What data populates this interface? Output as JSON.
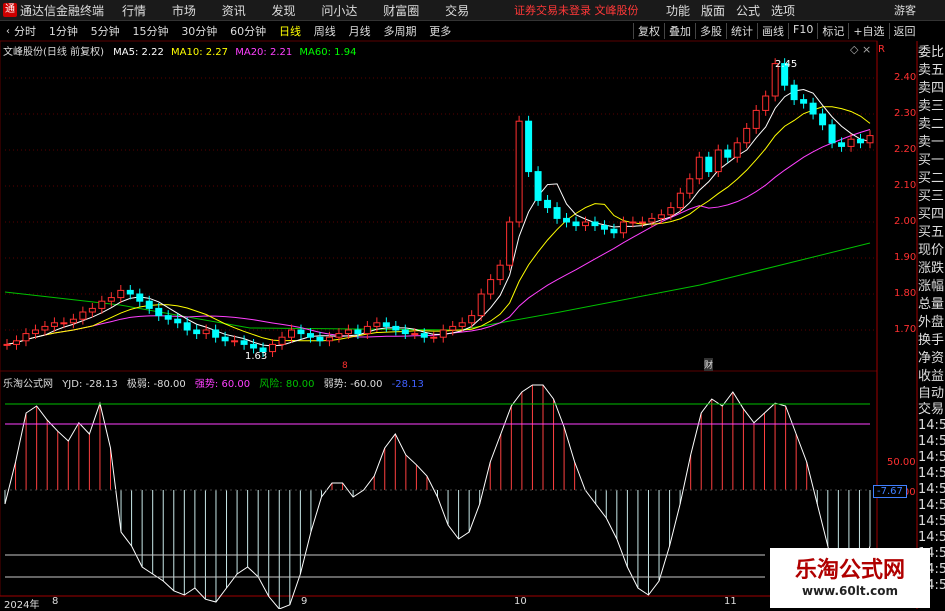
{
  "titlebar": {
    "logo": "通",
    "app_name": "通达信金融终端",
    "menus": [
      "行情",
      "市场",
      "资讯",
      "发现",
      "问小达",
      "财富圈",
      "交易"
    ],
    "notice": "证券交易未登录  文峰股份",
    "right_menus": [
      "功能",
      "版面",
      "公式",
      "选项"
    ],
    "guest": "游客"
  },
  "toolbar": {
    "periods": [
      "分时",
      "1分钟",
      "5分钟",
      "15分钟",
      "30分钟",
      "60分钟",
      "日线",
      "周线",
      "月线",
      "多周期",
      "更多"
    ],
    "active_period": "日线",
    "tools": [
      "复权",
      "叠加",
      "多股",
      "统计",
      "画线",
      "F10",
      "标记",
      "+自选",
      "返回"
    ]
  },
  "main_chart": {
    "stock_label": "文峰股份(日线 前复权)",
    "ma5": "MA5: 2.22",
    "ma10": "MA10: 2.27",
    "ma20": "MA20: 2.21",
    "ma60": "MA60: 1.94",
    "colors": {
      "ma5": "#ffffff",
      "ma10": "#ffff00",
      "ma20": "#ff40ff",
      "ma60": "#00ff00",
      "up": "#ff3030",
      "down": "#00ffff"
    },
    "price_ticks": [
      "2.40",
      "2.30",
      "2.20",
      "2.10",
      "2.00",
      "1.90",
      "1.80",
      "1.70"
    ],
    "high_label": "2.45",
    "low_label": "1.63",
    "event_marks": [
      "8",
      "财"
    ]
  },
  "indicator": {
    "name": "乐淘公式网",
    "yjd": "YJD: -28.13",
    "extreme_weak": "极弱: -80.00",
    "strong": "强势: 60.00",
    "risk": "风险: 80.00",
    "weak": "弱势: -60.00",
    "current": "-28.13",
    "ticks": [
      "50.00",
      "25.00"
    ],
    "value_badge": "-7.67"
  },
  "side_panel": {
    "items": [
      "委比",
      "卖五",
      "卖四",
      "卖三",
      "卖二",
      "卖一",
      "买一",
      "买二",
      "买三",
      "买四",
      "买五",
      "现价",
      "涨跌",
      "涨幅",
      "总量",
      "外盘",
      "换手",
      "净资",
      "收益"
    ],
    "lower": [
      "自动",
      "交易",
      "14:56",
      "14:56",
      "14:56",
      "14:56",
      "14:56",
      "14:56",
      "14:56",
      "14:56",
      "14:56",
      "14:56",
      "14:56"
    ]
  },
  "dates": [
    "2024年",
    "8",
    "9",
    "10",
    "11"
  ],
  "watermark": {
    "title": "乐淘公式网",
    "url": "www.60lt.com"
  }
}
